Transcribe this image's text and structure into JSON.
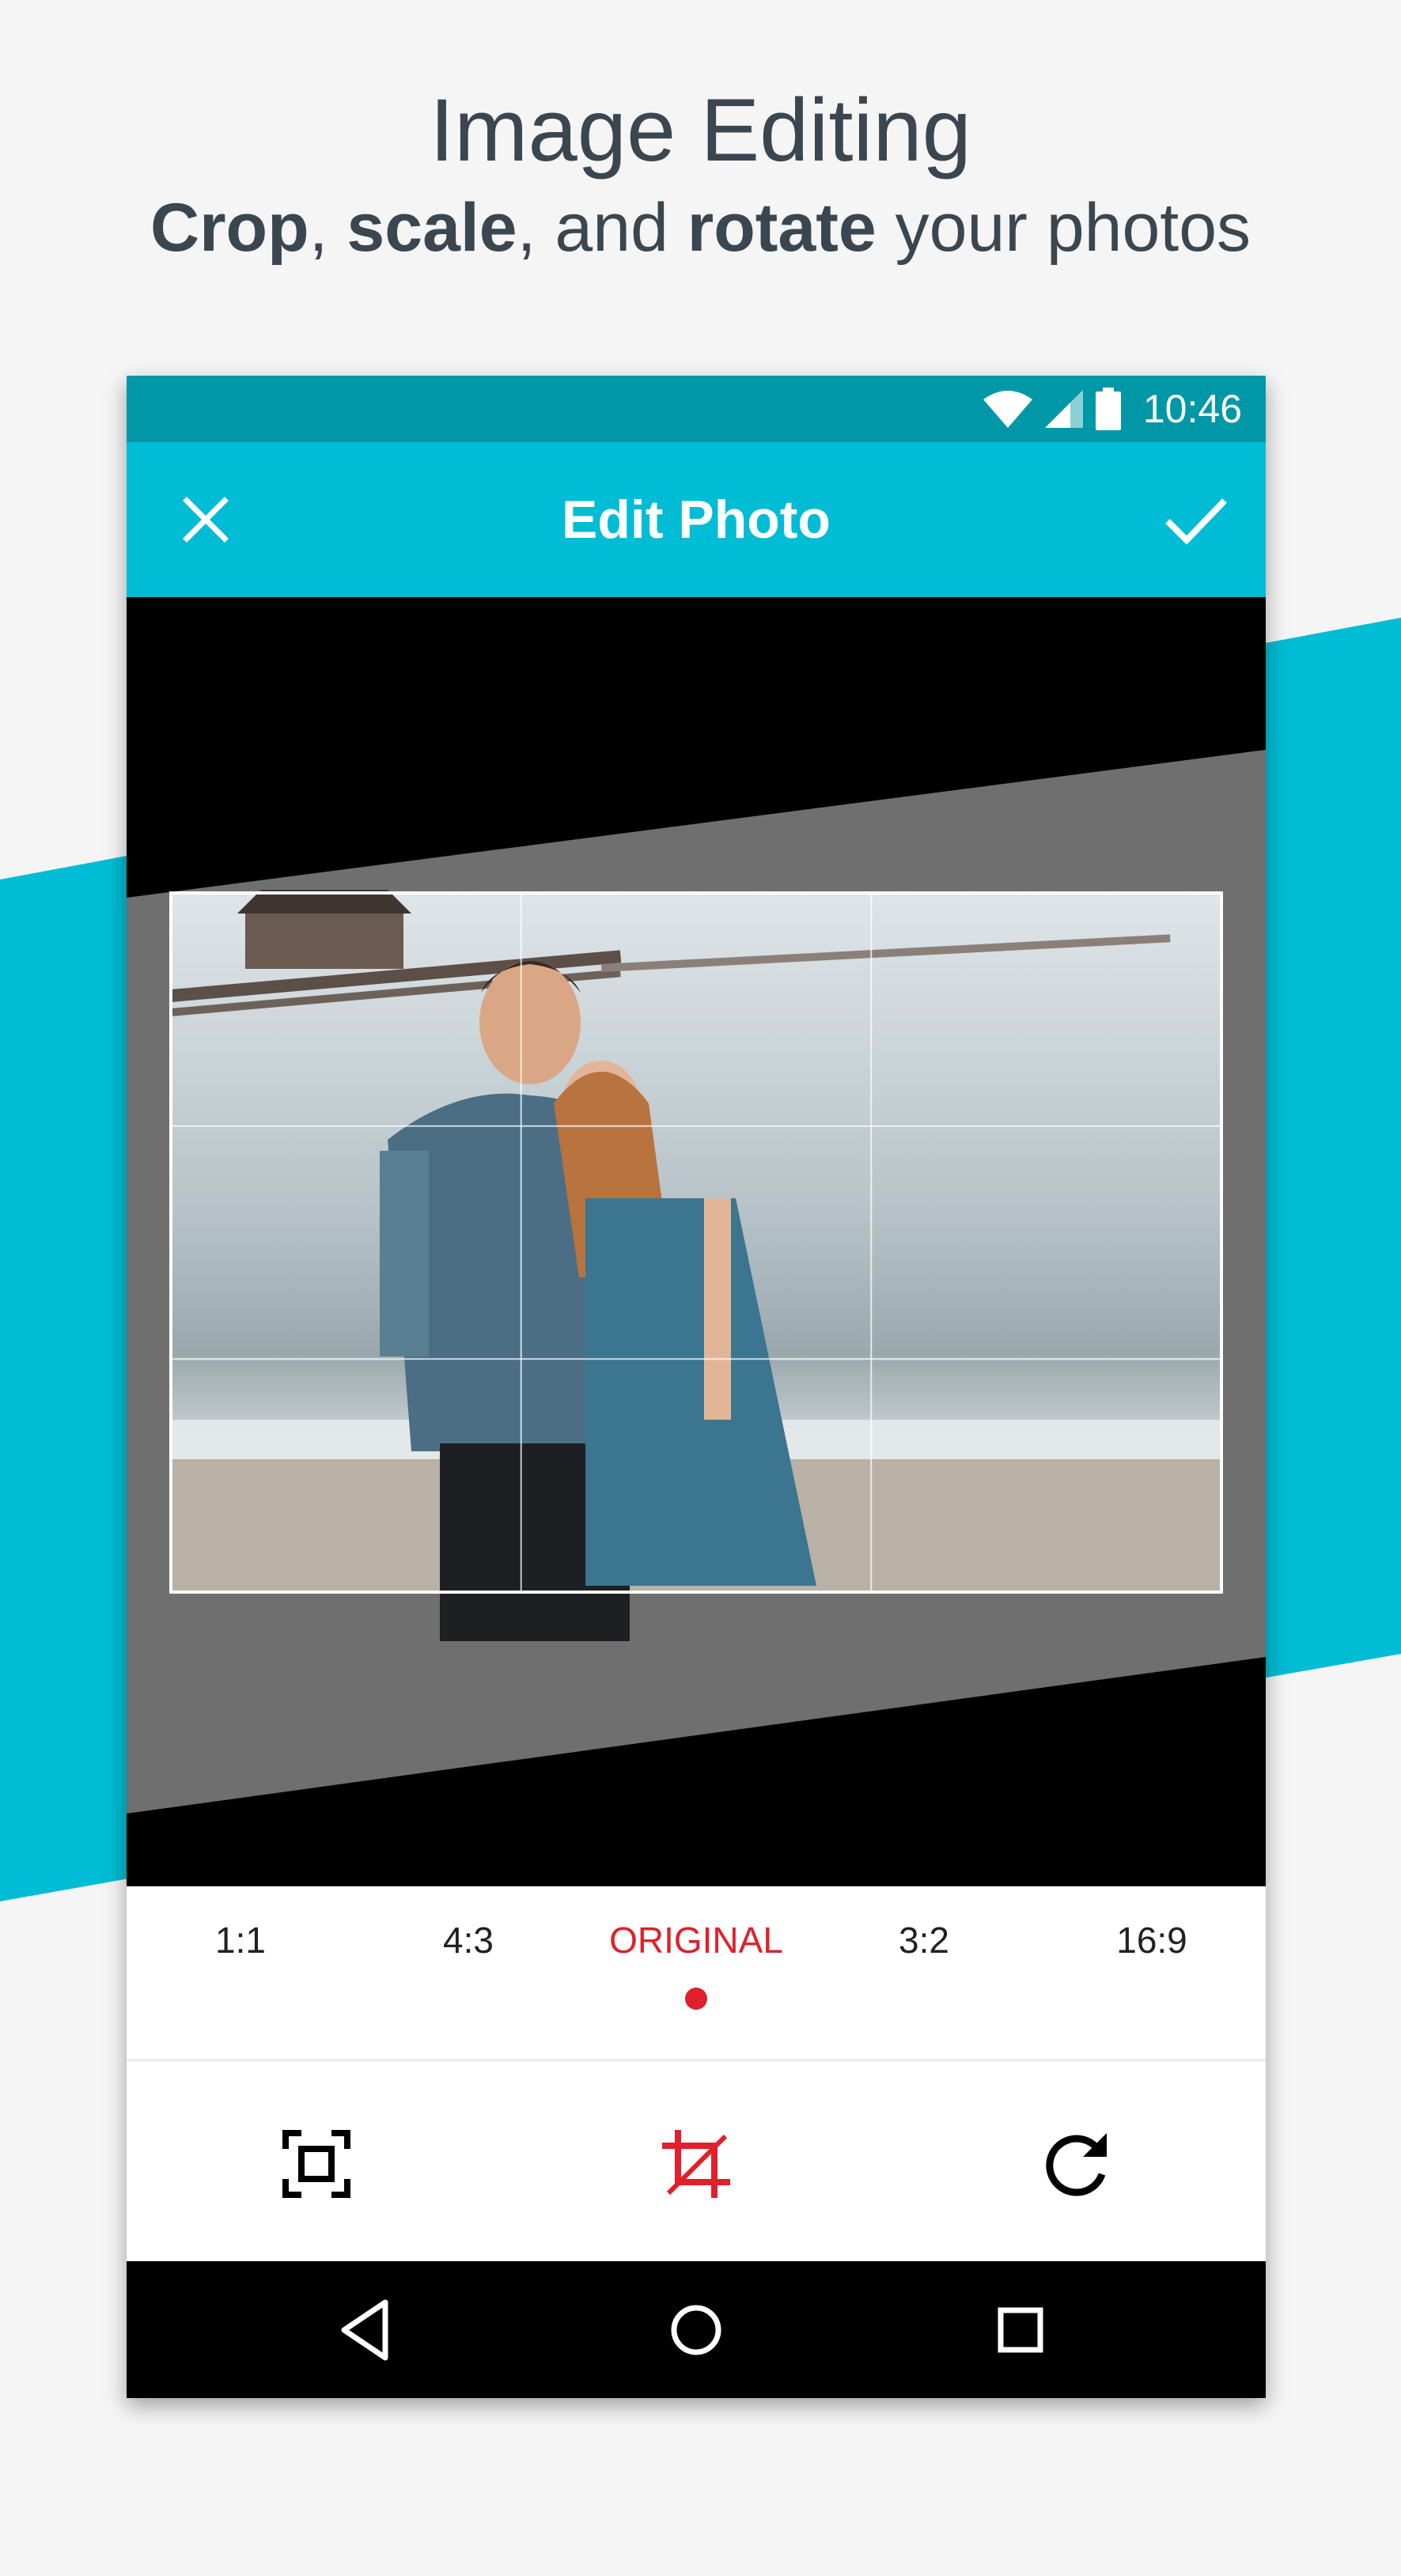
{
  "promo": {
    "title": "Image Editing",
    "sub_bold1": "Crop",
    "sub_text1": ", ",
    "sub_bold2": "scale",
    "sub_text2": ", and ",
    "sub_bold3": "rotate",
    "sub_text3": " your photos"
  },
  "status_bar": {
    "time": "10:46",
    "icons": [
      "wifi-icon",
      "cell-signal-icon",
      "battery-icon"
    ]
  },
  "app_bar": {
    "title": "Edit Photo",
    "left_icon": "close-icon",
    "right_icon": "check-icon"
  },
  "aspect_ratios": {
    "items": [
      "1:1",
      "4:3",
      "ORIGINAL",
      "3:2",
      "16:9"
    ],
    "selected": "ORIGINAL"
  },
  "tools": [
    "fit-screen-icon",
    "crop-icon",
    "rotate-icon"
  ],
  "nav": [
    "back-icon",
    "home-icon",
    "recents-icon"
  ],
  "colors": {
    "accent": "#00bcd4",
    "status_bar": "#0097a7",
    "selected": "#e0202a",
    "promo_text": "#3a4650",
    "background": "#f5f5f5"
  }
}
